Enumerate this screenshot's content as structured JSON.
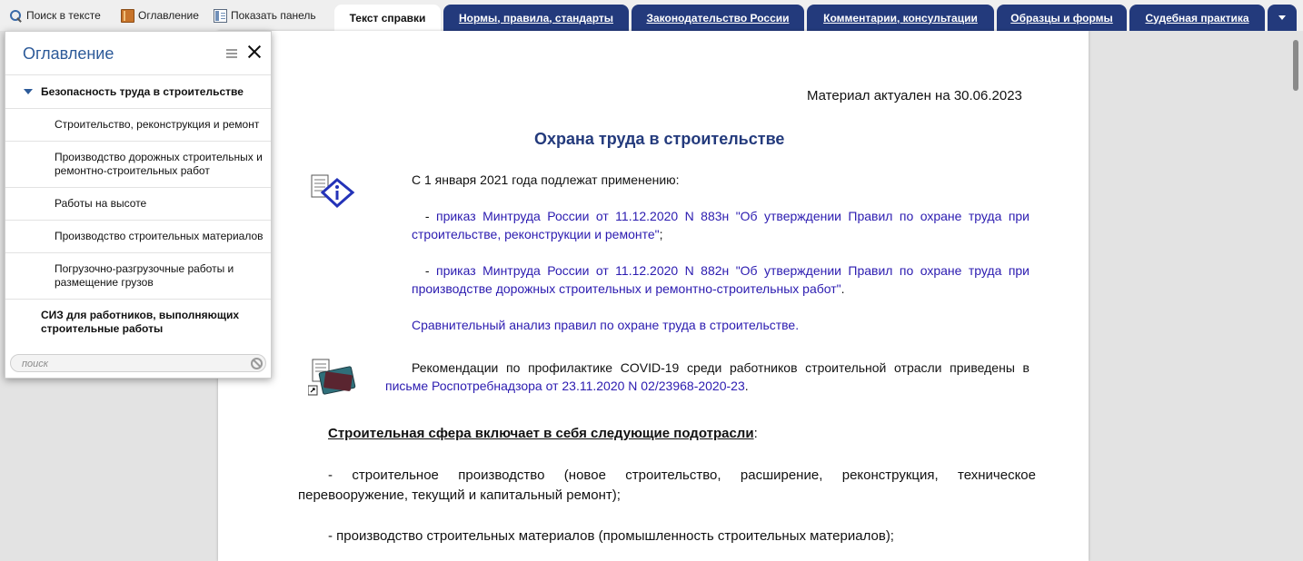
{
  "toolbar": {
    "search_label": "Поиск в тексте",
    "toc_label": "Оглавление",
    "panel_label": "Показать панель"
  },
  "tabs": [
    {
      "label": "Текст справки",
      "active": true
    },
    {
      "label": "Нормы, правила, стандарты",
      "active": false
    },
    {
      "label": "Законодательство России",
      "active": false
    },
    {
      "label": "Комментарии, консультации",
      "active": false
    },
    {
      "label": "Образцы и формы",
      "active": false
    },
    {
      "label": "Судебная практика",
      "active": false
    }
  ],
  "colors": {
    "tab_dark": "#233a7c",
    "link": "#2b1bb0",
    "title": "#233a7c",
    "toc_title": "#2c5a99"
  },
  "toc": {
    "title": "Оглавление",
    "items": [
      {
        "label": "Безопасность труда в строительстве",
        "level": 0,
        "expanded": true
      },
      {
        "label": "Строительство, реконструкция и ремонт",
        "level": 1
      },
      {
        "label": "Производство дорожных строительных и ремонтно-строительных работ",
        "level": 1
      },
      {
        "label": "Работы на высоте",
        "level": 1
      },
      {
        "label": "Производство строительных материалов",
        "level": 1
      },
      {
        "label": "Погрузочно-разгрузочные работы и размещение грузов",
        "level": 1
      },
      {
        "label": "СИЗ для работников, выполняющих строительные работы",
        "level": 0
      }
    ],
    "search_placeholder": "поиск"
  },
  "document": {
    "actual_date": "Материал актуален на 30.06.2023",
    "title": "Охрана труда в строительстве",
    "intro": "С 1 января 2021 года подлежат применению:",
    "order1_prefix": "- ",
    "order1_link": "приказ Минтруда России от 11.12.2020 N 883н \"Об утверждении Правил по охране труда при строительстве, реконструкции и ремонте\"",
    "order1_suffix": ";",
    "order2_prefix": "- ",
    "order2_link": "приказ Минтруда России от 11.12.2020 N 882н \"Об утверждении Правил по охране труда при производстве дорожных строительных и ремонтно-строительных работ\"",
    "order2_suffix": ".",
    "compare_link": "Сравнительный анализ правил по охране труда в строительстве.",
    "covid_text": "Рекомендации по профилактике COVID-19 среди работников строительной отрасли приведены в ",
    "covid_link": "письме Роспотребнадзора от 23.11.2020 N 02/23968-2020-23",
    "covid_suffix": ".",
    "sector_heading": "Строительная сфера включает в себя следующие подотрасли",
    "sector_heading_suffix": ":",
    "sector1": "- строительное производство (новое строительство, расширение, реконструкция, техническое перевооружение, текущий и капитальный ремонт);",
    "sector2": "- производство строительных материалов (промышленность строительных материалов);"
  }
}
